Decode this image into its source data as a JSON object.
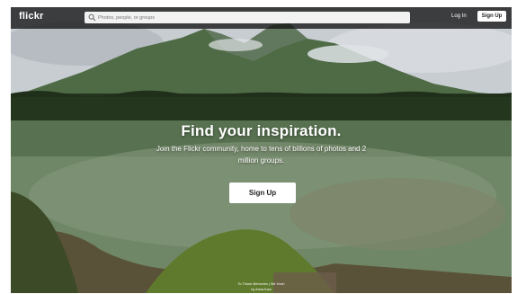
{
  "header": {
    "logo": "flickr",
    "search_placeholder": "Photos, people, or groups",
    "login_label": "Log In",
    "signup_label": "Sign Up"
  },
  "hero": {
    "title": "Find your inspiration.",
    "subtitle": "Join the Flickr community, home to tens of billions of photos and 2 million groups.",
    "cta_label": "Sign Up"
  },
  "photo_credit": {
    "title": "To Those Memories | Wir Hoch",
    "author": "by Anna Kwa"
  },
  "colors": {
    "header_bg": "#141414",
    "button_bg": "#ffffff",
    "text_light": "#ffffff"
  }
}
